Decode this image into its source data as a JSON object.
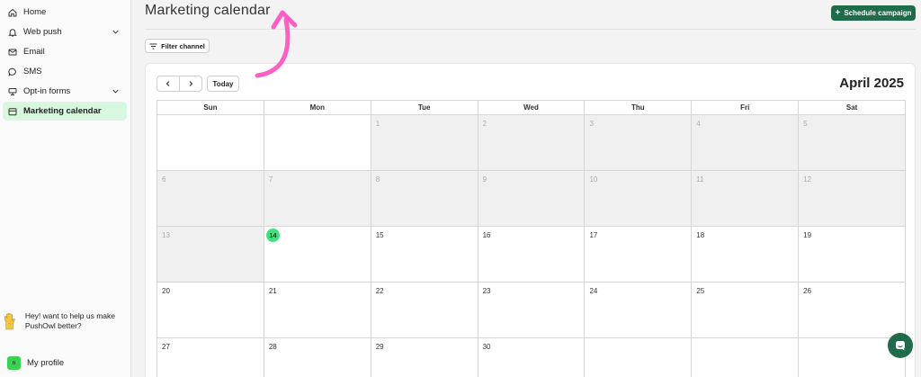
{
  "sidebar": {
    "items": [
      {
        "label": "Home",
        "icon": "home-icon"
      },
      {
        "label": "Web push",
        "icon": "bell-icon"
      },
      {
        "label": "Email",
        "icon": "mail-icon"
      },
      {
        "label": "SMS",
        "icon": "chat-icon"
      },
      {
        "label": "Opt-in forms",
        "icon": "form-icon"
      },
      {
        "label": "Marketing calendar",
        "icon": "calendar-icon"
      }
    ],
    "promo": "Hey! want to help us make PushOwl better?",
    "profile_label": "My profile",
    "avatar_text": "n"
  },
  "header": {
    "title": "Marketing calendar",
    "schedule_label": "Schedule campaign",
    "filter_label": "Filter channel"
  },
  "calendar": {
    "today_label": "Today",
    "month_title": "April 2025",
    "weekdays": [
      "Sun",
      "Mon",
      "Tue",
      "Wed",
      "Thu",
      "Fri",
      "Sat"
    ],
    "weeks": [
      [
        "",
        "",
        "1",
        "2",
        "3",
        "4",
        "5"
      ],
      [
        "6",
        "7",
        "8",
        "9",
        "10",
        "11",
        "12"
      ],
      [
        "13",
        "14",
        "15",
        "16",
        "17",
        "18",
        "19"
      ],
      [
        "20",
        "21",
        "22",
        "23",
        "24",
        "25",
        "26"
      ],
      [
        "27",
        "28",
        "29",
        "30",
        "",
        "",
        ""
      ]
    ],
    "today": "14"
  },
  "colors": {
    "accent": "#1f6b4a",
    "active_nav": "#d7f7df",
    "today_marker": "#41e07f",
    "annotation_arrow": "#ff5ec4"
  }
}
